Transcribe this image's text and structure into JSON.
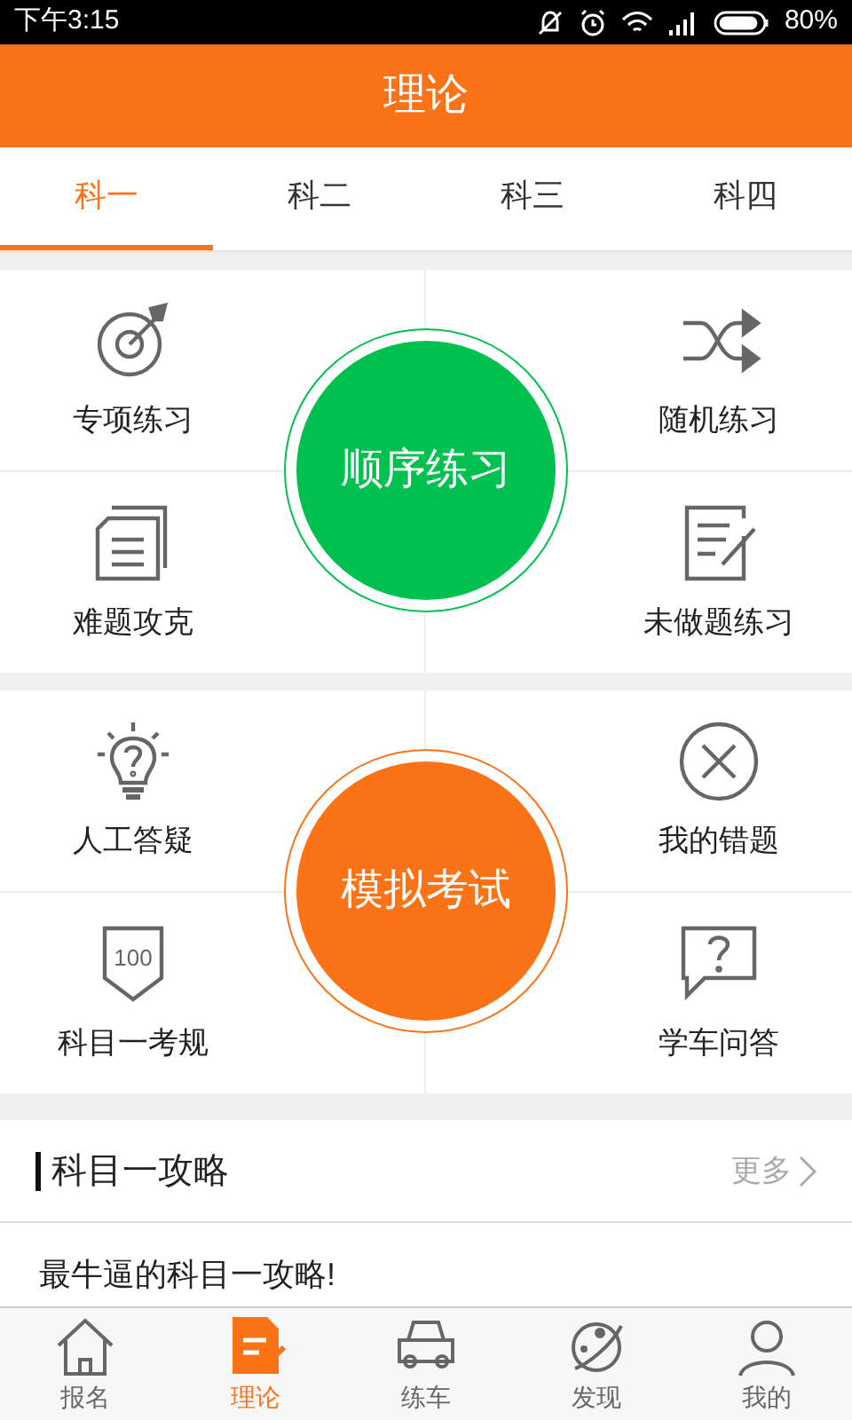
{
  "status_bar": {
    "time": "下午3:15",
    "battery": "80%"
  },
  "header": {
    "title": "理论"
  },
  "tabs": [
    {
      "label": "科一",
      "selected": true
    },
    {
      "label": "科二",
      "selected": false
    },
    {
      "label": "科三",
      "selected": false
    },
    {
      "label": "科四",
      "selected": false
    }
  ],
  "sections": [
    {
      "center": {
        "label": "顺序练习",
        "color": "#00c150"
      },
      "items": [
        {
          "label": "专项练习"
        },
        {
          "label": "随机练习"
        },
        {
          "label": "难题攻克"
        },
        {
          "label": "未做题练习"
        }
      ]
    },
    {
      "center": {
        "label": "模拟考试",
        "color": "#fc7216"
      },
      "items": [
        {
          "label": "人工答疑"
        },
        {
          "label": "我的错题"
        },
        {
          "label": "科目一考规",
          "icon_text": "100"
        },
        {
          "label": "学车问答"
        }
      ]
    }
  ],
  "guide": {
    "title": "科目一攻略",
    "more": "更多",
    "articles": [
      "最牛逼的科目一攻略!"
    ]
  },
  "bottom_nav": [
    {
      "label": "报名",
      "selected": false
    },
    {
      "label": "理论",
      "selected": true
    },
    {
      "label": "练车",
      "selected": false
    },
    {
      "label": "发现",
      "selected": false
    },
    {
      "label": "我的",
      "selected": false
    }
  ]
}
